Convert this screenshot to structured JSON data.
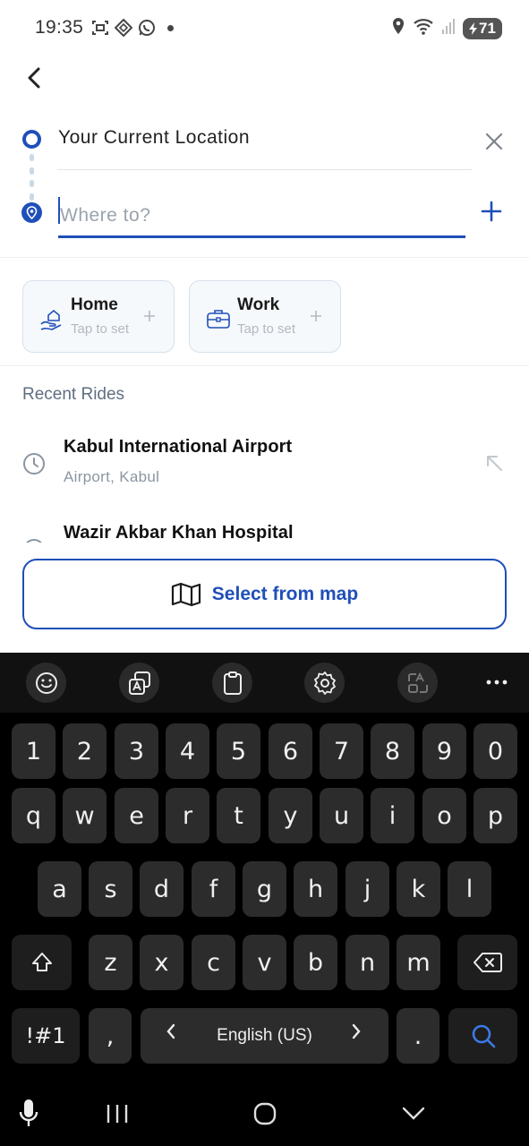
{
  "status_bar": {
    "time": "19:35",
    "battery": "71",
    "icons": [
      "screenshot-icon",
      "app-icon",
      "whatsapp-icon",
      "notification-dot",
      "location-icon",
      "wifi-icon",
      "signal-icon",
      "battery-icon"
    ]
  },
  "route": {
    "origin_text": "Your Current Location",
    "destination_placeholder": "Where to?",
    "destination_value": ""
  },
  "saved_places": [
    {
      "title": "Home",
      "subtitle": "Tap to set",
      "icon": "home-hand-icon"
    },
    {
      "title": "Work",
      "subtitle": "Tap to set",
      "icon": "briefcase-icon"
    }
  ],
  "recent": {
    "section_title": "Recent Rides",
    "items": [
      {
        "title": "Kabul International Airport",
        "subtitle": "Airport, Kabul"
      },
      {
        "title": "Wazir Akbar Khan Hospital",
        "subtitle": ""
      }
    ]
  },
  "map_button": {
    "label": "Select from map",
    "icon": "map-icon"
  },
  "keyboard": {
    "number_row": [
      "1",
      "2",
      "3",
      "4",
      "5",
      "6",
      "7",
      "8",
      "9",
      "0"
    ],
    "row1": [
      "q",
      "w",
      "e",
      "r",
      "t",
      "y",
      "u",
      "i",
      "o",
      "p"
    ],
    "row2": [
      "a",
      "s",
      "d",
      "f",
      "g",
      "h",
      "j",
      "k",
      "l"
    ],
    "row3": [
      "z",
      "x",
      "c",
      "v",
      "b",
      "n",
      "m"
    ],
    "symbols_key": "!#1",
    "comma_key": ",",
    "language": "English (US)",
    "period_key": ".",
    "toolbar_icons": [
      "emoji-icon",
      "translate-icon",
      "clipboard-icon",
      "settings-icon",
      "text-edit-icon",
      "more-icon"
    ]
  },
  "colors": {
    "accent": "#1f4fb8",
    "muted_text": "#8b96a1",
    "keyboard_bg": "#000000",
    "key_bg": "#2c2c2c"
  }
}
